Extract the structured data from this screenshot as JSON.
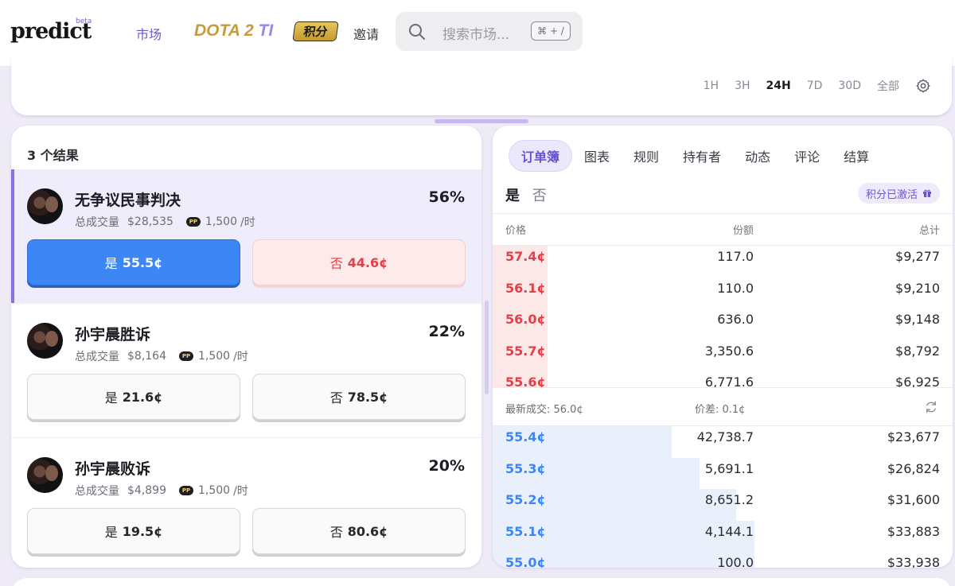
{
  "header": {
    "logo": "predict",
    "logo_badge": "beta",
    "nav_market": "市场",
    "nav_dota": "DOTA 2",
    "nav_dota_suffix": "TI",
    "nav_points": "积分",
    "nav_invite": "邀请",
    "search_placeholder": "搜索市场...",
    "search_shortcut": "⌘ + /"
  },
  "timeframes": {
    "items": [
      "1H",
      "3H",
      "24H",
      "7D",
      "30D",
      "全部"
    ],
    "active": "24H"
  },
  "results": {
    "count_label": "3 个结果",
    "volume_label": "总成交量",
    "rate_unit": "/时",
    "items": [
      {
        "name": "无争议民事判决",
        "pct": "56%",
        "volume": "$28,535",
        "rate": "1,500",
        "yes_label": "是",
        "yes_price": "55.5¢",
        "no_label": "否",
        "no_price": "44.6¢",
        "selected": true
      },
      {
        "name": "孙宇晨胜诉",
        "pct": "22%",
        "volume": "$8,164",
        "rate": "1,500",
        "yes_label": "是",
        "yes_price": "21.6¢",
        "no_label": "否",
        "no_price": "78.5¢",
        "selected": false
      },
      {
        "name": "孙宇晨败诉",
        "pct": "20%",
        "volume": "$4,899",
        "rate": "1,500",
        "yes_label": "是",
        "yes_price": "19.5¢",
        "no_label": "否",
        "no_price": "80.6¢",
        "selected": false
      }
    ]
  },
  "orderbook": {
    "tabs": [
      "订单簿",
      "图表",
      "规则",
      "持有者",
      "动态",
      "评论",
      "结算"
    ],
    "active_tab": "订单簿",
    "side_yes": "是",
    "side_no": "否",
    "points_badge": "积分已激活",
    "col_price": "价格",
    "col_shares": "份额",
    "col_total": "总计",
    "asks": [
      {
        "price": "57.4¢",
        "shares": "117.0",
        "total": "$9,277",
        "depth": 0.12
      },
      {
        "price": "56.1¢",
        "shares": "110.0",
        "total": "$9,210",
        "depth": 0.12
      },
      {
        "price": "56.0¢",
        "shares": "636.0",
        "total": "$9,148",
        "depth": 0.12
      },
      {
        "price": "55.7¢",
        "shares": "3,350.6",
        "total": "$8,792",
        "depth": 0.12
      },
      {
        "price": "55.6¢",
        "shares": "6,771.6",
        "total": "$6,925",
        "depth": 0.12
      }
    ],
    "last_trade": "最新成交: 56.0¢",
    "spread": "价差: 0.1¢",
    "bids": [
      {
        "price": "55.4¢",
        "shares": "42,738.7",
        "total": "$23,677",
        "depth": 0.39
      },
      {
        "price": "55.3¢",
        "shares": "5,691.1",
        "total": "$26,824",
        "depth": 0.45
      },
      {
        "price": "55.2¢",
        "shares": "8,651.2",
        "total": "$31,600",
        "depth": 0.53
      },
      {
        "price": "55.1¢",
        "shares": "4,144.1",
        "total": "$33,883",
        "depth": 0.57
      },
      {
        "price": "55.0¢",
        "shares": "100.0",
        "total": "$33,938",
        "depth": 0.57
      }
    ]
  },
  "colors": {
    "accent": "#6a52d6",
    "yes_blue": "#3d86f5",
    "no_red": "#e0414a",
    "background": "#eeeaf6"
  }
}
